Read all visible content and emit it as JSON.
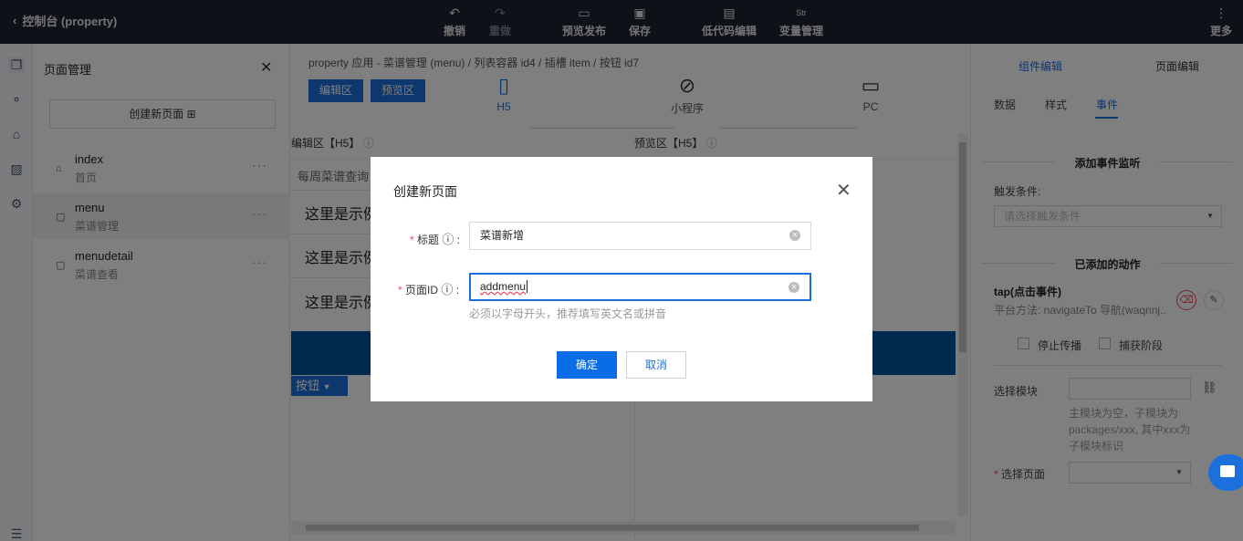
{
  "topbar": {
    "back_label": "控制台 (property)",
    "tools": [
      {
        "label": "撤销",
        "icon": "undo-icon",
        "glyph": "↶",
        "disabled": false
      },
      {
        "label": "重做",
        "icon": "redo-icon",
        "glyph": "↷",
        "disabled": true
      },
      {
        "label": "预览发布",
        "icon": "preview-publish-icon",
        "glyph": "▭",
        "disabled": false
      },
      {
        "label": "保存",
        "icon": "save-icon",
        "glyph": "▣",
        "disabled": false
      },
      {
        "label": "低代码编辑",
        "icon": "lowcode-icon",
        "glyph": "▤",
        "disabled": false
      },
      {
        "label": "变量管理",
        "icon": "variable-icon",
        "glyph": "Str",
        "disabled": false
      }
    ],
    "more_label": "更多"
  },
  "page_panel": {
    "title": "页面管理",
    "create_label": "创建新页面",
    "pages": [
      {
        "name": "index",
        "sub": "首页",
        "icon": "home-icon"
      },
      {
        "name": "menu",
        "sub": "菜谱管理",
        "icon": "file-icon"
      },
      {
        "name": "menudetail",
        "sub": "菜谱查看",
        "icon": "file-icon"
      }
    ]
  },
  "center": {
    "breadcrumb": "property 应用 - 菜谱管理 (menu)  /  列表容器 id4  /  插槽 item  /  按钮 id7",
    "edit_area_btn": "编辑区",
    "preview_area_btn": "预览区",
    "devices": [
      "H5",
      "小程序",
      "PC"
    ],
    "edit_header": "编辑区【H5】",
    "preview_header": "预览区【H5】",
    "list_header": "每周菜谱查询",
    "list_items": [
      "这里是示例",
      "这里是示例",
      "这里是示例"
    ],
    "chip_label": "按钮"
  },
  "right_panel": {
    "tabs": [
      "组件编辑",
      "页面编辑"
    ],
    "subtabs": [
      "数据",
      "样式",
      "事件"
    ],
    "section_listen": "添加事件监听",
    "trigger_label": "触发条件:",
    "trigger_placeholder": "请选择触发条件",
    "section_actions": "已添加的动作",
    "action_title": "tap(点击事件)",
    "action_desc": "平台方法: navigateTo 导航(waqnnj...",
    "stop_label": "停止传播",
    "capture_label": "捕获阶段",
    "module_label": "选择模块",
    "module_hint": "主模块为空，子模块为 packages/xxx, 其中xxx为子模块标识",
    "page_label": "选择页面"
  },
  "dialog": {
    "title": "创建新页面",
    "title_field_label": "标题",
    "title_field_value": "菜谱新增",
    "id_field_label": "页面ID",
    "id_field_value": "addmenu",
    "id_hint": "必须以字母开头，推荐填写英文名或拼音",
    "ok_label": "确定",
    "cancel_label": "取消"
  },
  "colors": {
    "primary": "#1d6fdc",
    "topbar": "#1e2330",
    "required": "#e34d59"
  }
}
